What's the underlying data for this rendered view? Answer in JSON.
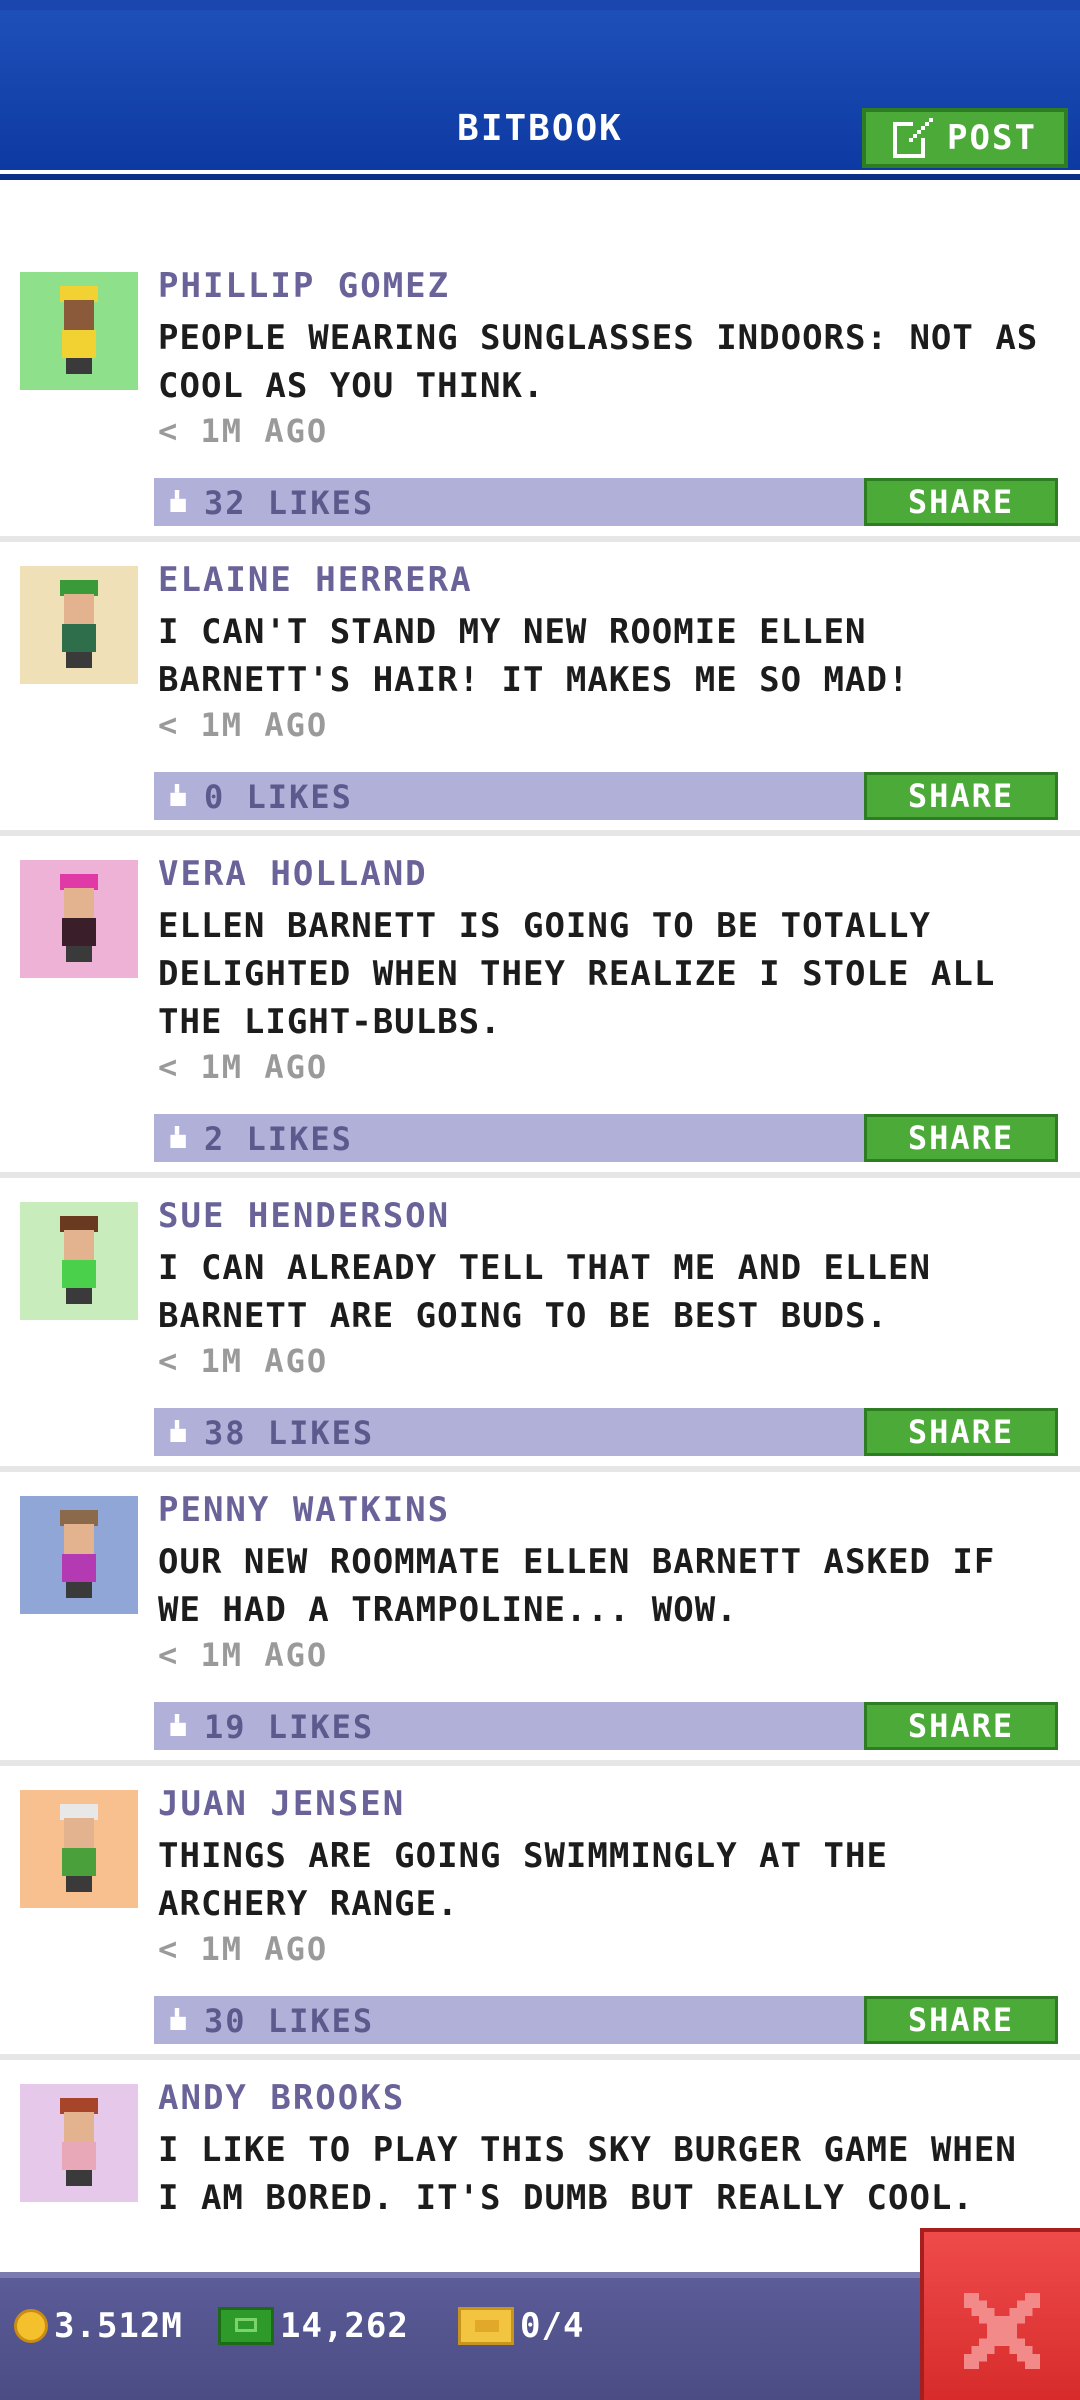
{
  "header": {
    "title": "BITBOOK",
    "post_label": "POST"
  },
  "posts": [
    {
      "name": "PHILLIP GOMEZ",
      "text": "PEOPLE WEARING SUNGLASSES INDOORS: NOT AS COOL AS YOU THINK.",
      "time": "< 1M AGO",
      "likes": "32 LIKES",
      "share": "SHARE",
      "avatar_bg": "#8ee08a",
      "hat": "#f2d233",
      "shirt": "#f2d233"
    },
    {
      "name": "ELAINE HERRERA",
      "text": "I CAN'T STAND MY NEW ROOMIE ELLEN BARNETT'S HAIR! IT MAKES ME SO MAD!",
      "time": "< 1M AGO",
      "likes": "0 LIKES",
      "share": "SHARE",
      "avatar_bg": "#f0e0b8",
      "hat": "#3a9a3a",
      "shirt": "#2e6e4a"
    },
    {
      "name": "VERA HOLLAND",
      "text": "ELLEN BARNETT IS GOING TO BE TOTALLY DELIGHTED WHEN THEY REALIZE I STOLE ALL THE LIGHT-BULBS.",
      "time": "< 1M AGO",
      "likes": "2 LIKES",
      "share": "SHARE",
      "avatar_bg": "#eeb2d6",
      "hat": "#e03aa6",
      "shirt": "#3a1f2a"
    },
    {
      "name": "SUE HENDERSON",
      "text": "I CAN ALREADY TELL THAT ME AND ELLEN BARNETT ARE GOING TO BE BEST BUDS.",
      "time": "< 1M AGO",
      "likes": "38 LIKES",
      "share": "SHARE",
      "avatar_bg": "#c8ecbc",
      "hat": "#6a3a20",
      "shirt": "#4ad04a"
    },
    {
      "name": "PENNY WATKINS",
      "text": "OUR NEW ROOMMATE ELLEN BARNETT ASKED IF WE HAD A TRAMPOLINE... WOW.",
      "time": "< 1M AGO",
      "likes": "19 LIKES",
      "share": "SHARE",
      "avatar_bg": "#8fa6d6",
      "hat": "#8a6a4a",
      "shirt": "#b43ab4"
    },
    {
      "name": "JUAN JENSEN",
      "text": "THINGS ARE GOING SWIMMINGLY AT THE ARCHERY RANGE.",
      "time": "< 1M AGO",
      "likes": "30 LIKES",
      "share": "SHARE",
      "avatar_bg": "#f7c08e",
      "hat": "#e8e8e8",
      "shirt": "#4aa03a"
    },
    {
      "name": "ANDY BROOKS",
      "text": "I LIKE TO PLAY THIS SKY BURGER GAME WHEN I AM BORED. IT'S DUMB BUT REALLY COOL.",
      "time": "",
      "likes": "",
      "share": "",
      "avatar_bg": "#e6c8ea",
      "hat": "#a8442a",
      "shirt": "#e8a8b8"
    }
  ],
  "footer": {
    "coins": "3.512M",
    "cash": "14,262",
    "tickets": "0/4"
  }
}
